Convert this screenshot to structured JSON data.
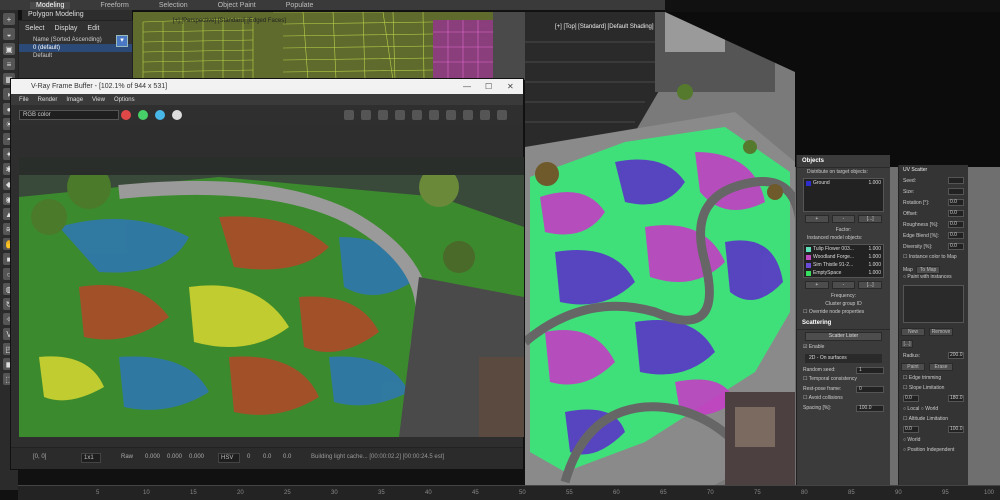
{
  "ribbon": {
    "tabs": [
      "Modeling",
      "Freeform",
      "Selection",
      "Object Paint",
      "Populate"
    ],
    "active_index": 0,
    "sub_label": "Polygon Modeling"
  },
  "explorer": {
    "menu": [
      "Select",
      "Display",
      "Edit"
    ],
    "sort_label": "Name (Sorted Ascending)",
    "selected_layer": "0 (default)",
    "child_row": "Default"
  },
  "viewports": {
    "top_label": "[+] [Perspective] [Standard] [Edged Faces]",
    "right_label": "[+] [Top] [Standard] [Default Shading]"
  },
  "vfb": {
    "title": "V-Ray Frame Buffer - [102.1% of 944 x 531]",
    "menu": [
      "File",
      "Render",
      "Image",
      "View",
      "Options"
    ],
    "channel": "RGB color",
    "status": {
      "coords": "[0, 0]",
      "zoom": "1x1",
      "raw_label": "Raw",
      "raw_vals": [
        "0.000",
        "0.000",
        "0.000"
      ],
      "mode": "HSV",
      "mode_vals": [
        "0",
        "0.0",
        "0.0"
      ],
      "message": "Building light cache... [00:00:02.2] [00:00:24.5 est]"
    }
  },
  "panel": {
    "objects_header": "Objects",
    "distribute_label": "Distribute on target objects:",
    "targets": [
      {
        "name": "Ground",
        "value": "1.000",
        "color": "#2e2ecc"
      }
    ],
    "target_buttons": [
      "+",
      "-",
      "[...]"
    ],
    "factor_label": "Factor:",
    "instanced_label": "Instanced model objects:",
    "instances": [
      {
        "name": "Tulip Flower 003...",
        "value": "1.000",
        "color": "#5fe0b8"
      },
      {
        "name": "Woodland Forge...",
        "value": "1.000",
        "color": "#c04cc2"
      },
      {
        "name": "Sim Thistle 91-2...",
        "value": "1.000",
        "color": "#6a4cd8"
      },
      {
        "name": "EmptySpace",
        "value": "1.000",
        "color": "#38e060"
      }
    ],
    "instance_buttons": [
      "+",
      "-",
      "[...]"
    ],
    "frequency_label": "Frequency:",
    "cluster_label": "Cluster group ID",
    "override_label": "Override node properties",
    "scattering_header": "Scattering",
    "scatter_lister": "Scatter Lister",
    "enable_label": "Enable",
    "mode_value": "2D - On surfaces",
    "random_seed_label": "Random seed:",
    "random_seed_value": "1",
    "temporal_label": "Temporal consistency",
    "rest_pose_label": "Rest-pose frame:",
    "rest_pose_value": "0",
    "avoid_label": "Avoid collisions",
    "spacing_label": "Spacing [%]:",
    "spacing_value": "100.0"
  },
  "panel2": {
    "header": "UV Scatter",
    "fields": [
      {
        "label": "Seed:",
        "value": ""
      },
      {
        "label": "Size:",
        "value": ""
      },
      {
        "label": "Rotation [°]:",
        "value": "0.0"
      },
      {
        "label": "Offset:",
        "value": "0.0"
      },
      {
        "label": "Roughness [%]:",
        "value": "0.0"
      },
      {
        "label": "Edge Blend [%]:",
        "value": "0.0"
      },
      {
        "label": "Diversity [%]:",
        "value": "0.0"
      }
    ],
    "instance_color": "Instance color to Map",
    "map_label": "Map",
    "map_btn": "To Map",
    "paint_label": "Paint with instances",
    "paint_buttons": [
      "New",
      "Remove",
      "[...]"
    ],
    "radius_label": "Radius:",
    "radius_value": "200.0",
    "paint_actions": [
      "Paint",
      "Erase"
    ],
    "edge_trim": "Edge trimming",
    "slope_header": "Slope Limitation",
    "slope_range": [
      "0.0",
      "180.0"
    ],
    "slope_modes": [
      "Local",
      "World"
    ],
    "altitude_header": "Altitude Limitation",
    "altitude_range": [
      "0.0",
      "100.0"
    ],
    "altitude_modes": [
      "World",
      "Position Independent"
    ]
  },
  "timeline": {
    "ticks": [
      "5",
      "10",
      "15",
      "20",
      "25",
      "30",
      "35",
      "40",
      "45",
      "50",
      "55",
      "60",
      "65",
      "70",
      "75",
      "80",
      "85",
      "90",
      "95",
      "100"
    ]
  }
}
